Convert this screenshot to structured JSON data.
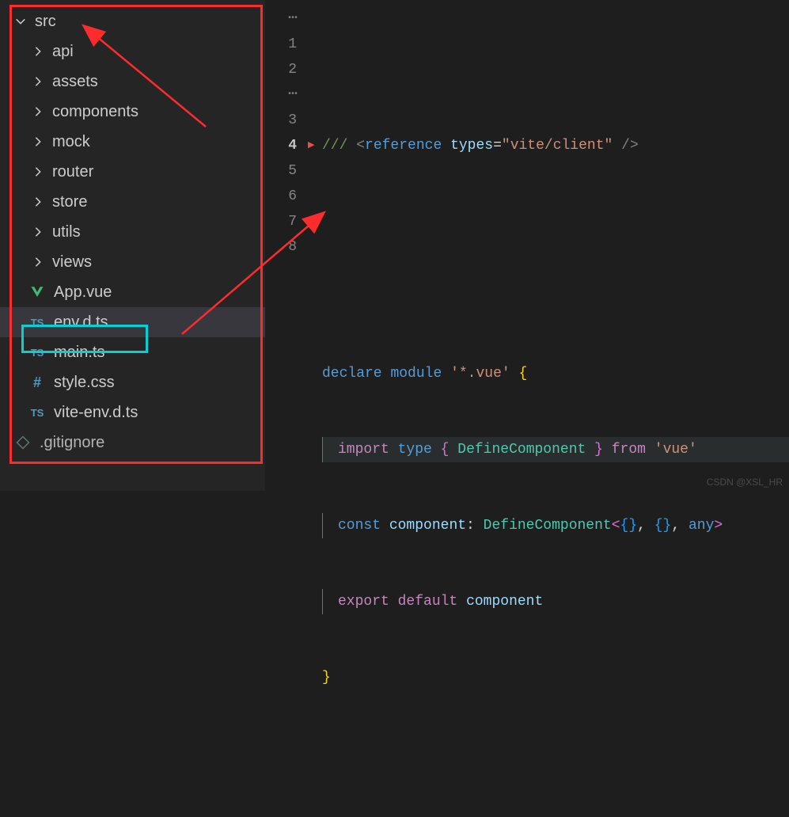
{
  "sidebar": {
    "root": {
      "name": "src",
      "expanded": true
    },
    "folders": [
      {
        "name": "api"
      },
      {
        "name": "assets"
      },
      {
        "name": "components"
      },
      {
        "name": "mock"
      },
      {
        "name": "router"
      },
      {
        "name": "store"
      },
      {
        "name": "utils"
      },
      {
        "name": "views"
      }
    ],
    "files": [
      {
        "name": "App.vue",
        "icon": "vue",
        "selected": false
      },
      {
        "name": "env.d.ts",
        "icon": "ts",
        "selected": true,
        "highlight": true
      },
      {
        "name": "main.ts",
        "icon": "ts",
        "selected": false
      },
      {
        "name": "style.css",
        "icon": "hash",
        "selected": false
      },
      {
        "name": "vite-env.d.ts",
        "icon": "ts",
        "selected": false
      }
    ],
    "outside": [
      {
        "name": ".gitignore",
        "icon": "git"
      }
    ]
  },
  "editor": {
    "line_numbers": [
      "1",
      "2",
      "3",
      "4",
      "5",
      "6",
      "7",
      "8"
    ],
    "active_line": 4,
    "code": {
      "l1": {
        "ref": "reference",
        "t": "types",
        "eq": "=",
        "s": "\"vite/client\"",
        "close": "/>"
      },
      "l3": {
        "k1": "declare",
        "k2": "module",
        "s": "'*.vue'",
        "b": "{"
      },
      "l4": {
        "k1": "import",
        "k2": "type",
        "lb": "{",
        "t": "DefineComponent",
        "rb": "}",
        "k3": "from",
        "s": "'vue'"
      },
      "l5": {
        "k1": "const",
        "v": "component",
        "col": ":",
        "t": "DefineComponent",
        "lt": "<",
        "b1": "{}",
        "c": ",",
        "b2": "{}",
        "a": "any",
        "gt": ">"
      },
      "l6": {
        "k1": "export",
        "k2": "default",
        "v": "component"
      },
      "l7": {
        "b": "}"
      }
    }
  },
  "watermark": "CSDN @XSL_HR"
}
